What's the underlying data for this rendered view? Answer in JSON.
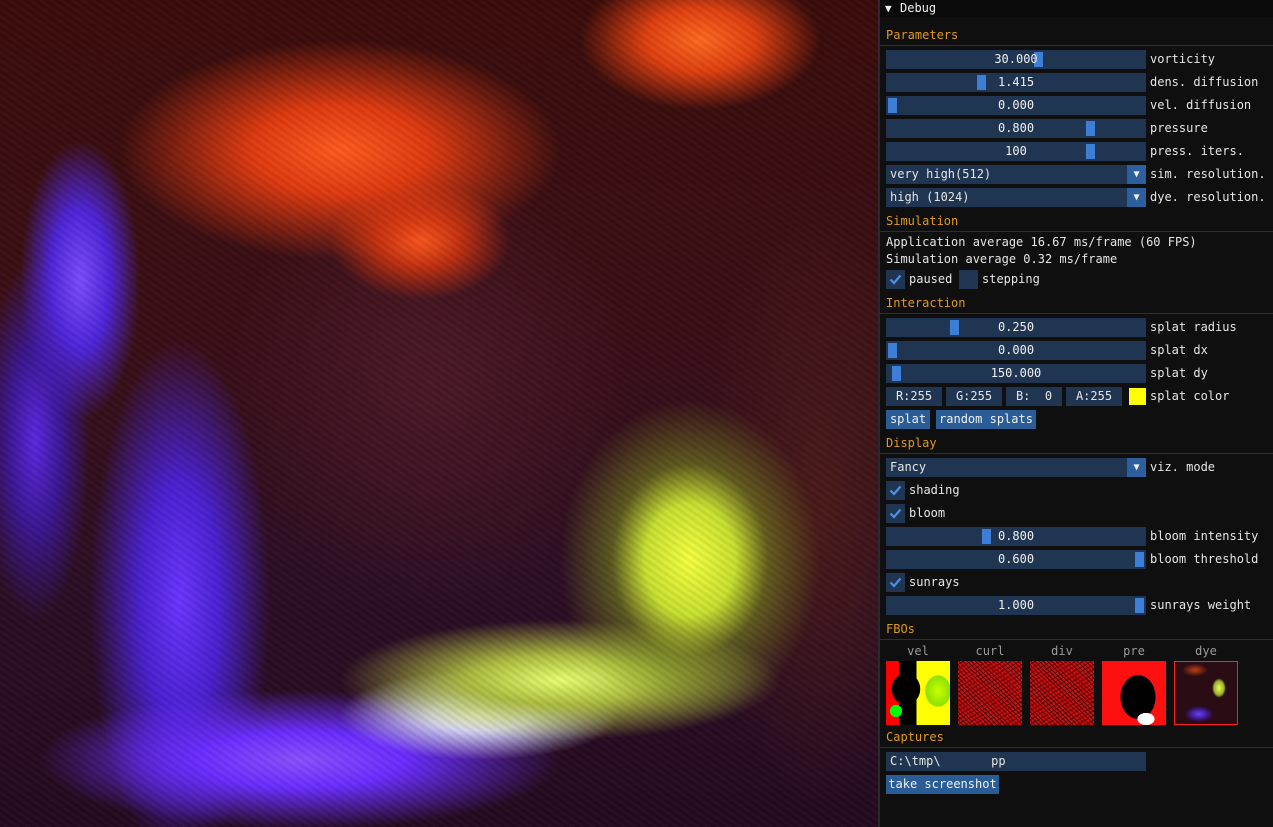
{
  "window": {
    "title": "Debug",
    "collapse_glyph": "▼"
  },
  "parameters": {
    "header": "Parameters",
    "sliders": [
      {
        "label": "vorticity",
        "value": "30.000",
        "fraction": 0.59
      },
      {
        "label": "dens. diffusion",
        "value": "1.415",
        "fraction": 0.36
      },
      {
        "label": "vel. diffusion",
        "value": "0.000",
        "fraction": 0.0
      },
      {
        "label": "pressure",
        "value": "0.800",
        "fraction": 0.8
      },
      {
        "label": "press. iters.",
        "value": "100",
        "fraction": 0.8
      }
    ],
    "sim_resolution": {
      "label": "sim. resolution.",
      "selected": "very high(512)"
    },
    "dye_resolution": {
      "label": "dye. resolution.",
      "selected": "high (1024)"
    }
  },
  "simulation": {
    "header": "Simulation",
    "app_average": "Application average 16.67 ms/frame (60 FPS)",
    "sim_average": "Simulation average 0.32 ms/frame",
    "paused": {
      "label": "paused",
      "checked": true
    },
    "stepping": {
      "label": "stepping",
      "checked": false
    }
  },
  "interaction": {
    "header": "Interaction",
    "sliders": [
      {
        "label": "splat radius",
        "value": "0.250",
        "fraction": 0.25
      },
      {
        "label": "splat dx",
        "value": "0.000",
        "fraction": 0.0
      },
      {
        "label": "splat dy",
        "value": "150.000",
        "fraction": 0.015
      }
    ],
    "color": {
      "r": "R:255",
      "g": "G:255",
      "b": "B:  0",
      "a": "A:255",
      "label": "splat color",
      "swatch": "#ffff00"
    },
    "splat_button": "splat",
    "random_splats_button": "random splats"
  },
  "display": {
    "header": "Display",
    "viz_mode": {
      "label": "viz. mode",
      "selected": "Fancy"
    },
    "shading": {
      "label": "shading",
      "checked": true
    },
    "bloom": {
      "label": "bloom",
      "checked": true
    },
    "bloom_intensity": {
      "label": "bloom intensity",
      "value": "0.800",
      "fraction": 0.38
    },
    "bloom_threshold": {
      "label": "bloom threshold",
      "value": "0.600",
      "fraction": 1.0
    },
    "sunrays": {
      "label": "sunrays",
      "checked": true
    },
    "sunrays_weight": {
      "label": "sunrays weight",
      "value": "1.000",
      "fraction": 1.0
    }
  },
  "fbos": {
    "header": "FBOs",
    "items": [
      "vel",
      "curl",
      "div",
      "pre",
      "dye"
    ]
  },
  "captures": {
    "header": "Captures",
    "path": "C:\\tmp\\       pp",
    "screenshot_button": "take screenshot"
  },
  "colors": {
    "accent": "#e09a1a",
    "frame_bg": "#1f3551",
    "grab": "#3d7ed6",
    "button": "#2a5d96"
  }
}
